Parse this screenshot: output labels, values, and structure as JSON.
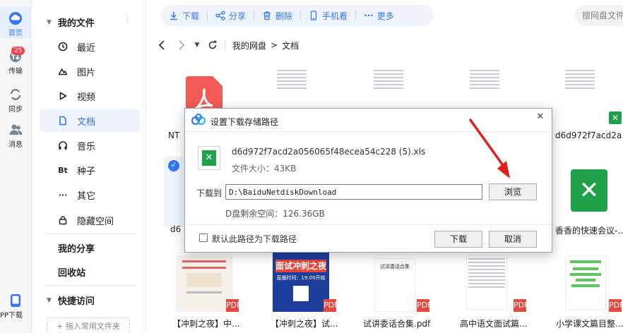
{
  "rail": {
    "home_label": "首页",
    "transfer_label": "传输",
    "transfer_badge": "25",
    "sync_label": "同步",
    "messages_label": "消息",
    "pc_download_label": "PP下载"
  },
  "sidebar": {
    "my_files": "我的文件",
    "items": [
      {
        "label": "最近",
        "icon": "clock-icon"
      },
      {
        "label": "图片",
        "icon": "image-icon"
      },
      {
        "label": "视频",
        "icon": "play-icon"
      },
      {
        "label": "文档",
        "icon": "document-icon"
      },
      {
        "label": "音乐",
        "icon": "headphones-icon"
      },
      {
        "label": "种子",
        "icon": "torrent-icon"
      },
      {
        "label": "其它",
        "icon": "more-icon"
      },
      {
        "label": "隐藏空间",
        "icon": "lock-icon"
      }
    ],
    "torrent_glyph": "Bt",
    "more_glyph": "···",
    "my_share": "我的分享",
    "recycle": "回收站",
    "quick_access": "快捷访问",
    "add_folder": "+ 拖入常用文件夹"
  },
  "toolbar": {
    "download": "下载",
    "share": "分享",
    "delete": "删除",
    "phone": "手机看",
    "more": "更多"
  },
  "search": {
    "placeholder": "搜网盘文件"
  },
  "breadcrumb": {
    "root": "我的网盘",
    "separator": ">",
    "current": "文档"
  },
  "files": {
    "row1_left_caption": "NT",
    "row1_right_caption": "d6d972f7acd2a...",
    "row2_left_caption": "d6",
    "row2_right_caption": "香香的快速会议-...",
    "row3": [
      {
        "caption": "【冲刺之夜】中..."
      },
      {
        "caption": "【冲刺之夜】试..."
      },
      {
        "caption": "试讲委话合集.pdf"
      },
      {
        "caption": "高中语文面试篇..."
      },
      {
        "caption": "小学课文篇目整..."
      }
    ],
    "poster_text": "面试冲刺之夜",
    "poster_sub": "直播时间：19:00开始",
    "doc_thumb_title": "试讲委话合集",
    "pdf_badge": "PDF"
  },
  "dialog": {
    "title": "设置下载存储路径",
    "file_name": "d6d972f7acd2a056065f48ecea54c228 (5).xls",
    "file_size": "文件大小：43KB",
    "download_to_label": "下载到",
    "path_value": "D:\\BaiduNetdiskDownload",
    "browse": "浏览",
    "free_space": "D盘剩余空间：126.36GB",
    "default_checkbox_label": "默认此路径为下载路径",
    "download": "下载",
    "cancel": "取消",
    "close_glyph": "✕"
  },
  "colors": {
    "accent": "#3476f6",
    "excel_green": "#1fa149",
    "pdf_red": "#e6493f",
    "annotation_red": "#e0201b"
  }
}
